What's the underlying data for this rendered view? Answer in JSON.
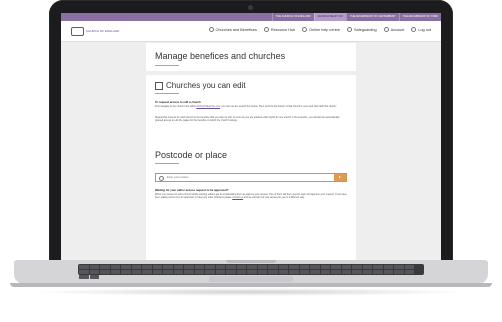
{
  "site": {
    "logo_text": "CHURCH OF ENGLAND",
    "top_links": [
      "THE CHURCH OF ENGLAND",
      "CHURCH NEAR YOU",
      "THE ARCHBISHOP OF CANTERBURY",
      "THE ARCHBISHOP OF YORK"
    ],
    "nav_links": [
      "Churches and Benefices",
      "Resource Hub",
      "Online help centre",
      "Safeguarding",
      "Account",
      "Log out"
    ]
  },
  "page": {
    "title": "Manage benefices and churches",
    "section_title": "Churches you can edit",
    "request_heading": "To request access to edit a church",
    "request_text_1": "First navigate to the church's list within ",
    "request_link": "AChurchNearYou.com",
    "request_text_2": ", you can use the search box below. Then scroll to the bottom of that church's menu and click 'Edit this church'.",
    "repeat_text": "Repeat this process for each church in the benefice that you want to edit. As soon as you are granted editor rights for one church in the benefice, you will also be automatically granted access to edit the pages for the benefice to which the church belongs.",
    "postcode_title": "Postcode or place",
    "search_placeholder": "Enter your location",
    "waiting_heading": "Waiting for your editor access request to be approved?",
    "waiting_text_1": "When you request to edit a church all the existing editors get an email asking them to approve your access. One of them will then need to login and approve your request. If you have been waiting some time for approval, or have any other problems please ",
    "waiting_link": "contact us",
    "waiting_text_2": " and we will sort out your access for you in a different way."
  },
  "colors": {
    "topbar": "#8a6fa5",
    "accent": "#c8a455",
    "search_button": "#e09a54"
  }
}
